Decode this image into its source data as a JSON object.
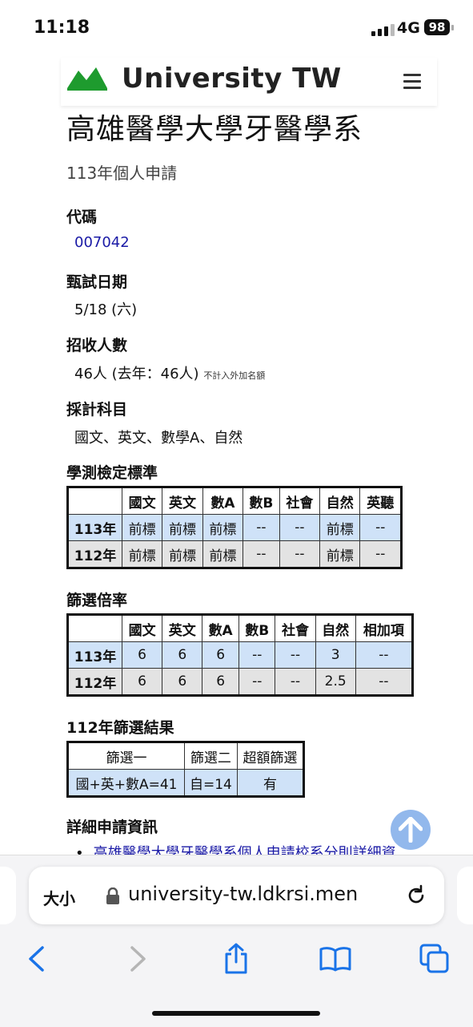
{
  "status": {
    "time": "11:18",
    "network": "4G",
    "battery": "98"
  },
  "header": {
    "site_title": "University TW",
    "logo_color": "#1e9b2e"
  },
  "page": {
    "title": "高雄醫學大學牙醫學系",
    "subtitle": "113年個人申請",
    "code_label": "代碼",
    "code_value": "007042",
    "exam_date_label": "甄試日期",
    "exam_date_value": "5/18 (六)",
    "enrollment_label": "招收人數",
    "enrollment_value": "46人 (去年：46人)",
    "enrollment_note": "不計入外加名額",
    "subjects_label": "採計科目",
    "subjects_value": "國文、英文、數學A、自然"
  },
  "standards": {
    "label": "學測檢定標準",
    "headers": [
      "",
      "國文",
      "英文",
      "數A",
      "數B",
      "社會",
      "自然",
      "英聽"
    ],
    "rows": [
      [
        "113年",
        "前標",
        "前標",
        "前標",
        "--",
        "--",
        "前標",
        "--"
      ],
      [
        "112年",
        "前標",
        "前標",
        "前標",
        "--",
        "--",
        "前標",
        "--"
      ]
    ]
  },
  "ratio": {
    "label": "篩選倍率",
    "headers": [
      "",
      "國文",
      "英文",
      "數A",
      "數B",
      "社會",
      "自然",
      "相加項"
    ],
    "rows": [
      [
        "113年",
        "6",
        "6",
        "6",
        "--",
        "--",
        "3",
        "--"
      ],
      [
        "112年",
        "6",
        "6",
        "6",
        "--",
        "--",
        "2.5",
        "--"
      ]
    ]
  },
  "result": {
    "label": "112年篩選結果",
    "headers": [
      "篩選一",
      "篩選二",
      "超額篩選"
    ],
    "row": [
      "國+英+數A=41",
      "自=14",
      "有"
    ]
  },
  "details": {
    "label": "詳細申請資訊",
    "link_text": "高雄醫學大學牙醫學系個人申請校系分則詳細資"
  },
  "browser": {
    "text_size": "大小",
    "url": "university-tw.ldkrsi.men"
  }
}
